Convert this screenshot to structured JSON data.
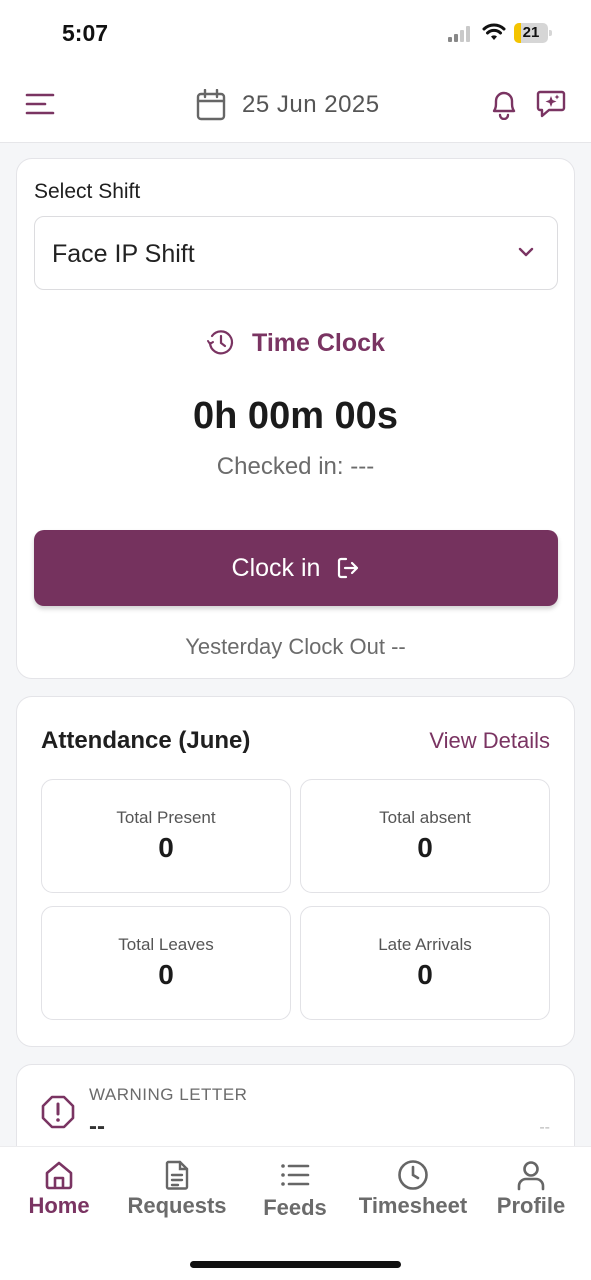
{
  "status_bar": {
    "time": "5:07",
    "battery_level": "21",
    "battery_fraction": 0.21
  },
  "header": {
    "menu_icon": "menu-icon",
    "calendar_icon": "calendar-icon",
    "date": "25 Jun 2025",
    "bell_icon": "bell-icon",
    "chat_icon": "chat-sparkle-icon"
  },
  "clock_card": {
    "select_label": "Select Shift",
    "selected_shift": "Face IP Shift",
    "time_clock_title": "Time Clock",
    "timer": "0h 00m 00s",
    "checked_in": "Checked in: ---",
    "clock_in_label": "Clock in",
    "yesterday": "Yesterday Clock Out --"
  },
  "attendance": {
    "title": "Attendance (June)",
    "view_details": "View Details",
    "stats": [
      {
        "label": "Total Present",
        "value": "0"
      },
      {
        "label": "Total absent",
        "value": "0"
      },
      {
        "label": "Total Leaves",
        "value": "0"
      },
      {
        "label": "Late Arrivals",
        "value": "0"
      }
    ]
  },
  "warning": {
    "label": "WARNING LETTER",
    "value": "--",
    "right_value": "--"
  },
  "tabs": [
    {
      "label": "Home",
      "icon": "home-icon",
      "active": true
    },
    {
      "label": "Requests",
      "icon": "document-icon",
      "active": false
    },
    {
      "label": "Feeds",
      "icon": "list-icon",
      "active": false
    },
    {
      "label": "Timesheet",
      "icon": "clock-icon",
      "active": false
    },
    {
      "label": "Profile",
      "icon": "user-icon",
      "active": false
    }
  ],
  "colors": {
    "brand": "#75325e",
    "brand_text": "#7a3462",
    "background": "#f5f6f8",
    "battery": "#f4c400"
  }
}
